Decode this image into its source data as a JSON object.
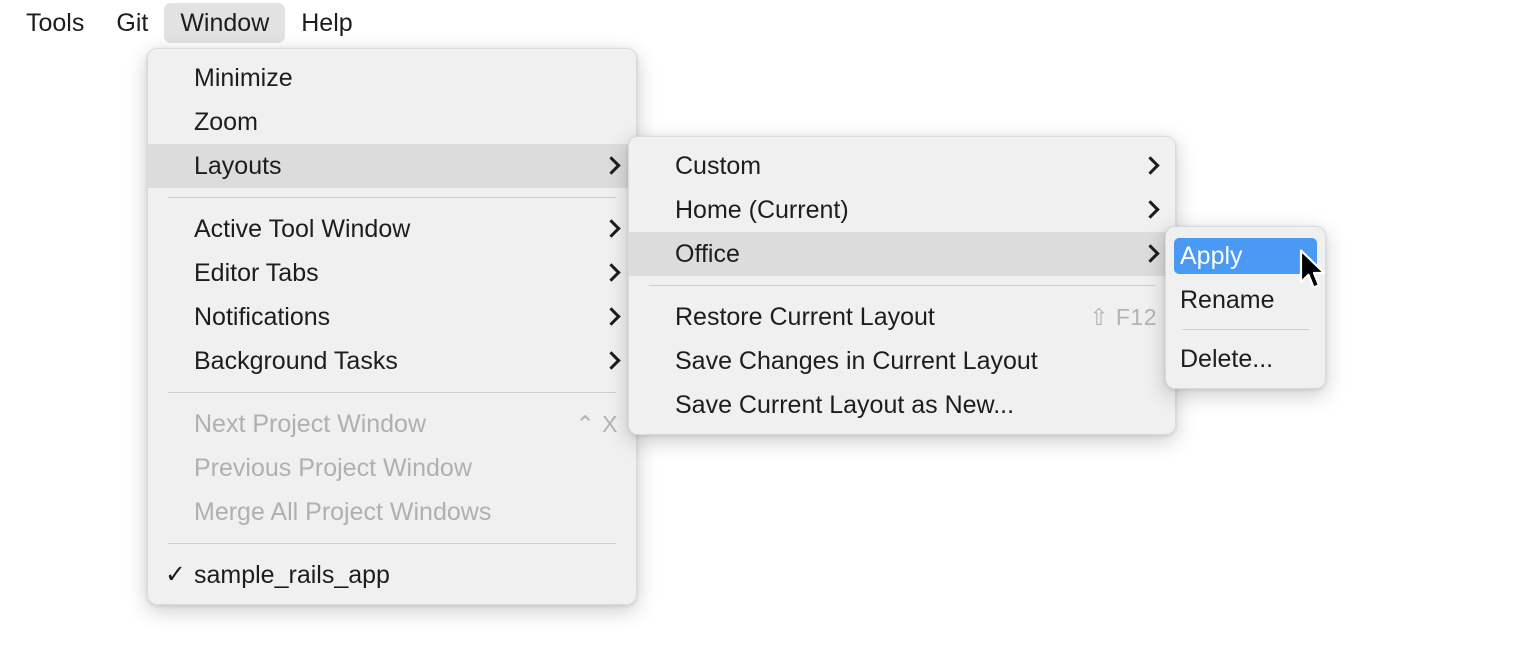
{
  "menubar": {
    "items": [
      {
        "label": "Tools",
        "active": false
      },
      {
        "label": "Git",
        "active": false
      },
      {
        "label": "Window",
        "active": true
      },
      {
        "label": "Help",
        "active": false
      }
    ]
  },
  "menu_window": {
    "items": [
      {
        "label": "Minimize"
      },
      {
        "label": "Zoom"
      },
      {
        "label": "Layouts"
      },
      {
        "label": "Active Tool Window"
      },
      {
        "label": "Editor Tabs"
      },
      {
        "label": "Notifications"
      },
      {
        "label": "Background Tasks"
      },
      {
        "label": "Next Project Window",
        "shortcut": "⌃ X"
      },
      {
        "label": "Previous Project Window"
      },
      {
        "label": "Merge All Project Windows"
      },
      {
        "label": "sample_rails_app",
        "check": "✓"
      }
    ]
  },
  "menu_layouts": {
    "items": [
      {
        "label": "Custom"
      },
      {
        "label": "Home (Current)"
      },
      {
        "label": "Office"
      },
      {
        "label": "Restore Current Layout",
        "shortcut": "⇧ F12"
      },
      {
        "label": "Save Changes in Current Layout"
      },
      {
        "label": "Save Current Layout as New..."
      }
    ]
  },
  "menu_office": {
    "items": [
      {
        "label": "Apply"
      },
      {
        "label": "Rename"
      },
      {
        "label": "Delete..."
      }
    ]
  },
  "colors": {
    "selection_blue": "#4a9af5",
    "hover_gray": "#dcdcdc",
    "menu_background": "#f0f0f0",
    "menubar_active": "#e2e2e2",
    "text": "#1d1d1f",
    "disabled_text": "#b0b0b0",
    "shortcut_text": "#b3b3b3"
  },
  "icons": {
    "submenu_chevron": "chevron-right-icon",
    "checkmark": "check-icon",
    "pointer": "mouse-pointer-icon"
  }
}
